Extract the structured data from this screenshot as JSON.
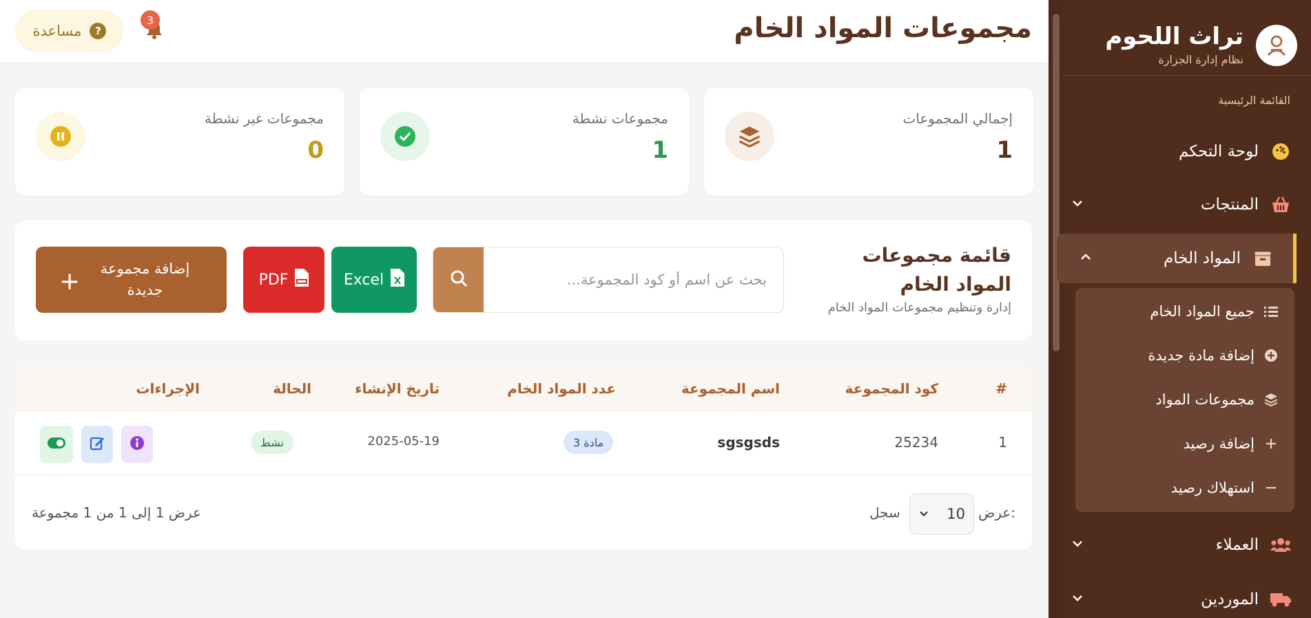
{
  "sidebar": {
    "brand_title": "تراث اللحوم",
    "brand_subtitle": "نظام إدارة الجزارة",
    "section_label": "القائمة الرئيسية",
    "items": [
      {
        "label": "لوحة التحكم",
        "icon": "gauge-icon"
      },
      {
        "label": "المنتجات",
        "icon": "basket-icon"
      },
      {
        "label": "المواد الخام",
        "icon": "box-icon"
      },
      {
        "label": "العملاء",
        "icon": "users-icon"
      },
      {
        "label": "الموردين",
        "icon": "truck-icon"
      }
    ],
    "sub_items": [
      {
        "label": "جميع المواد الخام",
        "icon": "list-icon"
      },
      {
        "label": "إضافة مادة جديدة",
        "icon": "plus-circle-icon"
      },
      {
        "label": "مجموعات المواد",
        "icon": "layers-icon"
      },
      {
        "label": "إضافة رصيد",
        "icon": "plus-icon"
      },
      {
        "label": "استهلاك رصيد",
        "icon": "minus-icon"
      }
    ],
    "accent_color": "#f4c542"
  },
  "header": {
    "title": "مجموعات المواد الخام",
    "help_label": "مساعدة",
    "notification_count": "3"
  },
  "stats": [
    {
      "label": "إجمالي المجموعات",
      "value": "1",
      "color": "#5a3420",
      "icon": "layers-icon"
    },
    {
      "label": "مجموعات نشطة",
      "value": "1",
      "color": "#2c9a4c",
      "icon": "check-circle-icon"
    },
    {
      "label": "مجموعات غير نشطة",
      "value": "0",
      "color": "#c29a1a",
      "icon": "pause-circle-icon"
    }
  ],
  "panel": {
    "title": "قائمة مجموعات المواد الخام",
    "subtitle": "إدارة وتنظيم مجموعات المواد الخام",
    "search_placeholder": "بحث عن اسم أو كود المجموعة...",
    "excel_label": "Excel",
    "pdf_label": "PDF",
    "add_label": "إضافة مجموعة جديدة"
  },
  "table": {
    "headers": [
      "#",
      "كود المجموعة",
      "اسم المجموعة",
      "عدد المواد الخام",
      "تاريخ الإنشاء",
      "الحالة",
      "الإجراءات"
    ],
    "rows": [
      {
        "index": "1",
        "code": "25234",
        "name": "sgsgsds",
        "count": "3 مادة",
        "date": "2025-05-19",
        "status": "نشط"
      }
    ],
    "show_label": "عرض:",
    "page_size": "10",
    "per_page_label": "سجل",
    "footer_count": "عرض 1 إلى 1 من 1 مجموعة"
  }
}
